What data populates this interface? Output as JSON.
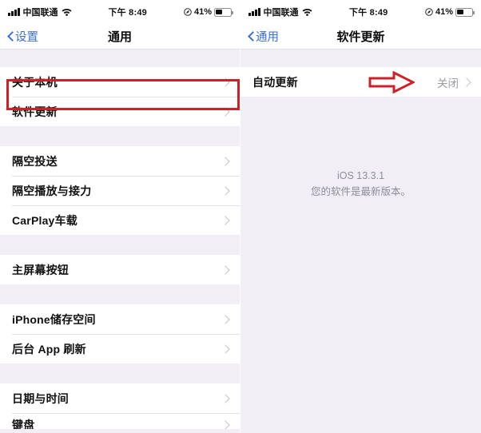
{
  "left_screen": {
    "status_bar": {
      "carrier": "中国联通",
      "time": "下午 8:49",
      "battery_percent": "41%",
      "signal_icon": "signal-bars-icon",
      "wifi_icon": "wifi-icon",
      "location_icon": "location-arrow-icon",
      "battery_icon": "battery-icon",
      "battery_level": 41
    },
    "nav": {
      "back_label": "设置",
      "back_icon": "chevron-left-icon",
      "title": "通用"
    },
    "sections": [
      {
        "rows": [
          {
            "label": "关于本机",
            "value": "",
            "chevron": "chevron-right-icon",
            "highlighted": false
          },
          {
            "label": "软件更新",
            "value": "",
            "chevron": "chevron-right-icon",
            "highlighted": true
          }
        ]
      },
      {
        "rows": [
          {
            "label": "隔空投送",
            "value": "",
            "chevron": "chevron-right-icon",
            "highlighted": false
          },
          {
            "label": "隔空播放与接力",
            "value": "",
            "chevron": "chevron-right-icon",
            "highlighted": false
          },
          {
            "label": "CarPlay车载",
            "value": "",
            "chevron": "chevron-right-icon",
            "highlighted": false
          }
        ]
      },
      {
        "rows": [
          {
            "label": "主屏幕按钮",
            "value": "",
            "chevron": "chevron-right-icon",
            "highlighted": false
          }
        ]
      },
      {
        "rows": [
          {
            "label": "iPhone储存空间",
            "value": "",
            "chevron": "chevron-right-icon",
            "highlighted": false
          },
          {
            "label": "后台 App 刷新",
            "value": "",
            "chevron": "chevron-right-icon",
            "highlighted": false
          }
        ]
      },
      {
        "rows": [
          {
            "label": "日期与时间",
            "value": "",
            "chevron": "chevron-right-icon",
            "highlighted": false
          },
          {
            "label": "键盘",
            "value": "",
            "chevron": "chevron-right-icon",
            "highlighted": false,
            "clipped": true
          }
        ]
      }
    ]
  },
  "right_screen": {
    "status_bar": {
      "carrier": "中国联通",
      "time": "下午 8:49",
      "battery_percent": "41%",
      "signal_icon": "signal-bars-icon",
      "wifi_icon": "wifi-icon",
      "location_icon": "location-arrow-icon",
      "battery_icon": "battery-icon",
      "battery_level": 41
    },
    "nav": {
      "back_label": "通用",
      "back_icon": "chevron-left-icon",
      "title": "软件更新"
    },
    "auto_update_row": {
      "label": "自动更新",
      "value": "关闭",
      "chevron": "chevron-right-icon"
    },
    "status_message": {
      "version": "iOS 13.3.1",
      "text": "您的软件是最新版本。"
    },
    "callout_arrow_icon": "red-arrow-right-icon"
  },
  "annotation_colors": {
    "highlight_red": "#cf2027",
    "accent_blue": "#3b6fd4",
    "page_background": "#f1eff5"
  }
}
